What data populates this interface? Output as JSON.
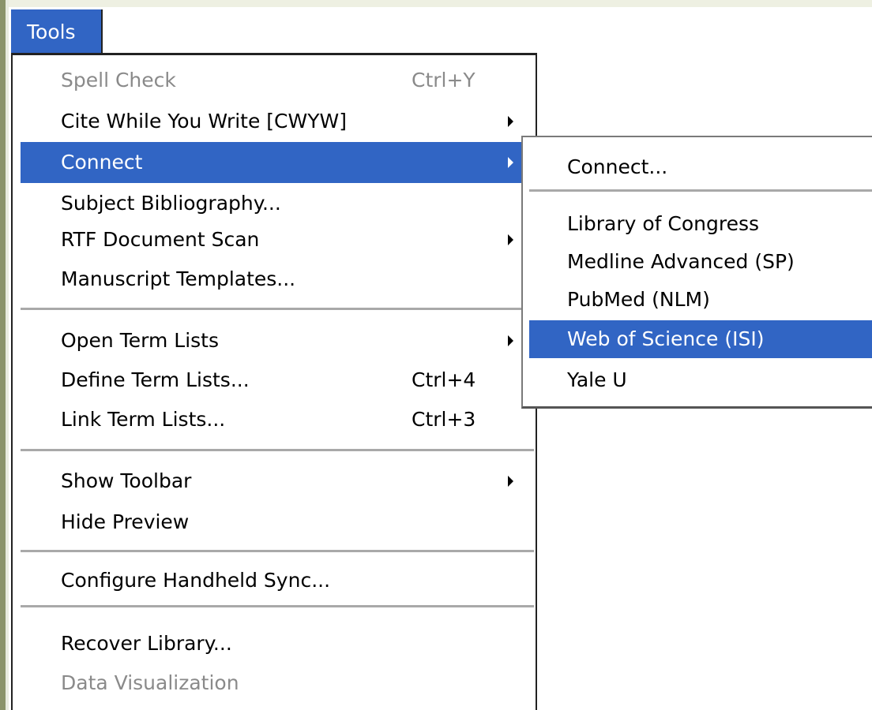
{
  "menubar": {
    "tools_label": "Tools"
  },
  "tools_menu": {
    "spell_check": {
      "label": "Spell Check",
      "shortcut": "Ctrl+Y"
    },
    "cite_while_you_write": {
      "label": "Cite While You Write [CWYW]"
    },
    "connect": {
      "label": "Connect"
    },
    "subject_bibliography": {
      "label": "Subject Bibliography..."
    },
    "rtf_document_scan": {
      "label": "RTF Document Scan"
    },
    "manuscript_templates": {
      "label": "Manuscript Templates..."
    },
    "open_term_lists": {
      "label": "Open Term Lists"
    },
    "define_term_lists": {
      "label": "Define Term Lists...",
      "shortcut": "Ctrl+4"
    },
    "link_term_lists": {
      "label": "Link Term Lists...",
      "shortcut": "Ctrl+3"
    },
    "show_toolbar": {
      "label": "Show Toolbar"
    },
    "hide_preview": {
      "label": "Hide Preview"
    },
    "configure_handheld_sync": {
      "label": "Configure Handheld Sync..."
    },
    "recover_library": {
      "label": "Recover Library..."
    },
    "data_visualization": {
      "label": "Data Visualization"
    }
  },
  "connect_submenu": {
    "connect": "Connect...",
    "library_of_congress": "Library of Congress",
    "medline_advanced": "Medline Advanced (SP)",
    "pubmed": "PubMed (NLM)",
    "web_of_science": "Web of Science (ISI)",
    "yale_u": "Yale U"
  },
  "colors": {
    "highlight": "#3165c4",
    "disabled_text": "#8a8a8a",
    "separator": "#a9a9a9"
  },
  "icons": {
    "submenu_arrow": "triangle-right"
  }
}
